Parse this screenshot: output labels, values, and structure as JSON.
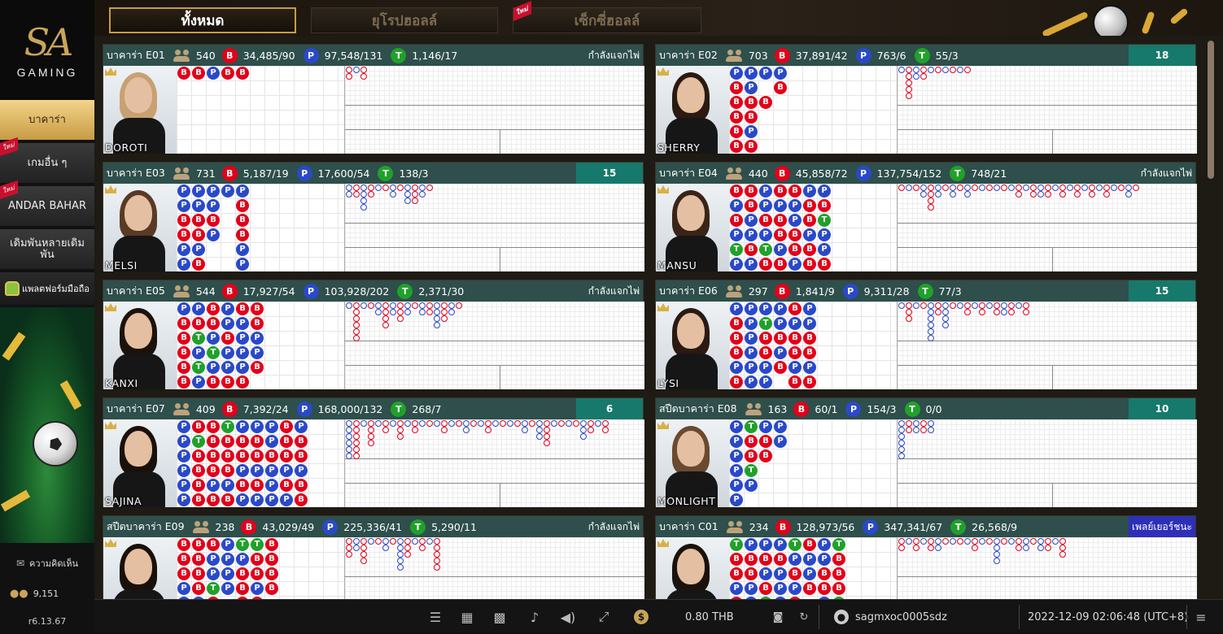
{
  "brand": {
    "logo_text": "SA",
    "logo_sub": "GAMING"
  },
  "sidebar": {
    "items": [
      {
        "label": "บาคาร่า",
        "active": true,
        "new": false
      },
      {
        "label": "เกมอื่น ๆ",
        "active": false,
        "new": true
      },
      {
        "label": "ANDAR BAHAR",
        "active": false,
        "new": true
      },
      {
        "label": "เดิมพันหลายเดิมพัน",
        "active": false,
        "new": false
      }
    ],
    "app_label": "แพลตฟอร์มมือถือ",
    "new_tag": "ใหม่",
    "feedback_label": "ความคิดเห็น",
    "online_count": "9,151",
    "version": "r6.13.67"
  },
  "tabs": [
    {
      "label": "ทั้งหมด",
      "active": true
    },
    {
      "label": "ยุโรปฮอลล์",
      "active": false
    },
    {
      "label": "เซ็กซี่ฮอลล์",
      "active": false,
      "new": true
    }
  ],
  "tables": [
    {
      "name": "บาคาร่า E01",
      "players": "540",
      "banker": "34,485/90",
      "player": "97,548/131",
      "tie": "1,146/17",
      "status": "กำลังแจกไพ่",
      "status_type": "dealing",
      "dealer": "DOROTI"
    },
    {
      "name": "บาคาร่า E02",
      "players": "703",
      "banker": "37,891/42",
      "player": "763/6",
      "tie": "55/3",
      "status": "18",
      "status_type": "countdown",
      "dealer": "SHERRY"
    },
    {
      "name": "บาคาร่า E03",
      "players": "731",
      "banker": "5,187/19",
      "player": "17,600/54",
      "tie": "138/3",
      "status": "15",
      "status_type": "countdown",
      "dealer": "MELSI"
    },
    {
      "name": "บาคาร่า E04",
      "players": "440",
      "banker": "45,858/72",
      "player": "137,754/152",
      "tie": "748/21",
      "status": "กำลังแจกไพ่",
      "status_type": "dealing",
      "dealer": "MANSU"
    },
    {
      "name": "บาคาร่า E05",
      "players": "544",
      "banker": "17,927/54",
      "player": "103,928/202",
      "tie": "2,371/30",
      "status": "กำลังแจกไพ่",
      "status_type": "dealing",
      "dealer": "KANXI"
    },
    {
      "name": "บาคาร่า E06",
      "players": "297",
      "banker": "1,841/9",
      "player": "9,311/28",
      "tie": "77/3",
      "status": "15",
      "status_type": "countdown",
      "dealer": "LYSI"
    },
    {
      "name": "บาคาร่า E07",
      "players": "409",
      "banker": "7,392/24",
      "player": "168,000/132",
      "tie": "268/7",
      "status": "6",
      "status_type": "countdown",
      "dealer": "SAJINA"
    },
    {
      "name": "สปีดบาคาร่า E08",
      "players": "163",
      "banker": "60/1",
      "player": "154/3",
      "tie": "0/0",
      "status": "10",
      "status_type": "countdown",
      "dealer": "MONLIGHT"
    },
    {
      "name": "สปีดบาคาร่า E09",
      "players": "238",
      "banker": "43,029/49",
      "player": "225,336/41",
      "tie": "5,290/11",
      "status": "กำลังแจกไพ่",
      "status_type": "dealing",
      "dealer": ""
    },
    {
      "name": "บาคาร่า C01",
      "players": "234",
      "banker": "128,973/56",
      "player": "347,341/67",
      "tie": "26,568/9",
      "status": "เพลย์เยอร์ชนะ",
      "status_type": "win",
      "dealer": ""
    }
  ],
  "badges": {
    "banker": "B",
    "player": "P",
    "tie": "T"
  },
  "beads": [
    [
      "B",
      "B",
      "P",
      "B",
      "B"
    ],
    [
      "PBBBBB",
      "PPBBPB",
      "P B",
      "PB"
    ],
    [
      "PPBBPP",
      "PPBBPB",
      "PPBP",
      "P",
      "PBBBPPB"
    ],
    [
      "BPBPTPBB",
      "BBPPBPPB",
      "PPBPTBPT",
      "BPBBPB",
      "BPPBBPBB",
      "PBBPBBPBB",
      "PBTPPB"
    ],
    [
      "PBBBBBB",
      "PBTPTPBB",
      "BBPTPBBB",
      "PPBPPB",
      "BPPPPB",
      "BBPPB"
    ],
    [
      "PBBBPB",
      "PPPPPPP",
      "PTBBPP",
      "PPBPB",
      "BPBBPBB",
      "PPBBPBB"
    ],
    [
      "PPPPPPP",
      "BTBBBBBP",
      "BBBBPBBP",
      "TBBBPBBPB",
      "PBBPBPPB",
      "PBBPBPB",
      "PPBPPPB",
      "BBBPBPBPP",
      "PBBPBB"
    ],
    [
      "PPPPPP",
      "TBBTP",
      "PBB",
      "PP"
    ],
    [
      "BBBPPT",
      "BBBBP",
      "BPPTB",
      "PPPP",
      "TPBBBP",
      "TBBPB",
      "BBBB"
    ],
    [
      "TBBPBB",
      "PBBPPTB",
      "PBPBTB",
      "PBPPP",
      "TPBPB",
      "BPPB",
      "PPBBP",
      "TBBBT"
    ]
  ],
  "bottombar": {
    "balance": "0.80 THB",
    "username": "sagmxoc0005sdz",
    "datetime": "2022-12-09  02:06:48 (UTC+8)"
  },
  "colors": {
    "banker": "#e2001a",
    "player": "#2a49c9",
    "tie": "#20a12a",
    "gold": "#c79b45",
    "header": "#2e4f4c",
    "countdown": "#17796b",
    "win": "#2e2fb8"
  }
}
